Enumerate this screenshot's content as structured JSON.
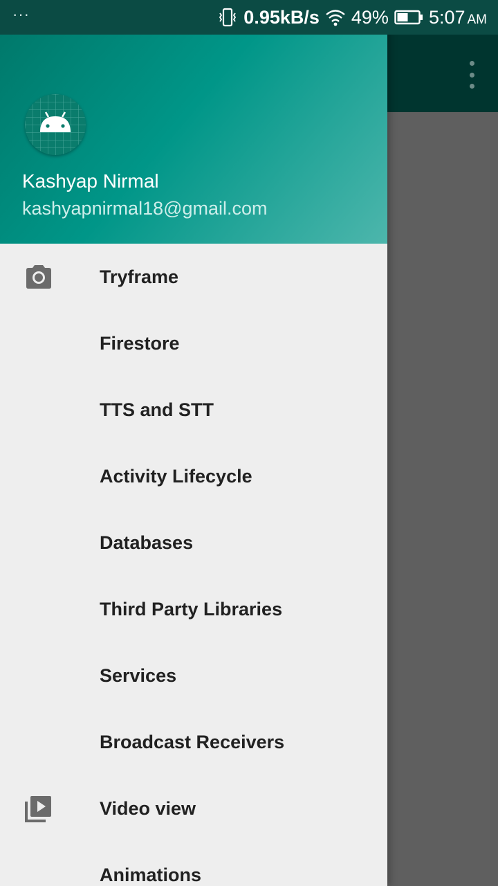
{
  "status_bar": {
    "notifications": "···",
    "net_speed": "0.95kB/s",
    "battery_percent": "49%",
    "time": "5:07",
    "ampm": "AM",
    "icons": [
      "vibrate-icon",
      "wifi-icon",
      "battery-icon"
    ]
  },
  "drawer": {
    "header": {
      "user_name": "Kashyap Nirmal",
      "user_email": "kashyapnirmal18@gmail.com",
      "avatar_icon": "android-icon"
    },
    "items": [
      {
        "label": "Tryframe",
        "icon": "camera-icon"
      },
      {
        "label": "Firestore",
        "icon": ""
      },
      {
        "label": "TTS and STT",
        "icon": ""
      },
      {
        "label": "Activity Lifecycle",
        "icon": ""
      },
      {
        "label": "Databases",
        "icon": ""
      },
      {
        "label": "Third Party Libraries",
        "icon": ""
      },
      {
        "label": "Services",
        "icon": ""
      },
      {
        "label": "Broadcast Receivers",
        "icon": ""
      },
      {
        "label": "Video view",
        "icon": "video-library-icon"
      },
      {
        "label": "Animations",
        "icon": ""
      }
    ]
  },
  "colors": {
    "header_start": "#00796b",
    "header_end": "#4db6ac",
    "toolbar": "#00352f",
    "scrim": "#5f5f5f"
  }
}
